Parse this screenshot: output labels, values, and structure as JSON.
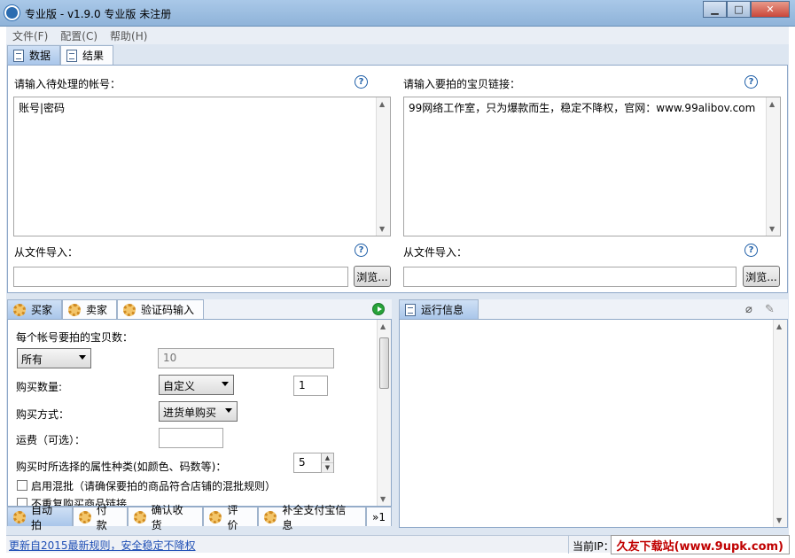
{
  "window": {
    "title": "专业版 - v1.9.0 专业版 未注册",
    "min": "▁",
    "max": "□",
    "close": "✕"
  },
  "menu": {
    "file": "文件(F)",
    "config": "配置(C)",
    "help": "帮助(H)"
  },
  "top_tabs": {
    "data": "数据",
    "result": "结果"
  },
  "accounts": {
    "label": "请输入待处理的帐号：",
    "value": "账号|密码",
    "import_label": "从文件导入：",
    "browse": "浏览..."
  },
  "links": {
    "label": "请输入要拍的宝贝链接：",
    "value": "99网络工作室，只为爆款而生，稳定不降权，官网：www.99alibov.com",
    "import_label": "从文件导入：",
    "browse": "浏览..."
  },
  "help": "?",
  "role_tabs": {
    "buyer": "买家",
    "seller": "卖家",
    "captcha": "验证码输入"
  },
  "buyer": {
    "items_label": "每个帐号要拍的宝贝数：",
    "items_select": "所有",
    "items_value": "10",
    "qty_label": "购买数量:",
    "qty_select": "自定义",
    "qty_value": "1",
    "method_label": "购买方式：",
    "method_select": "进货单购买",
    "shipping_label": "运费（可选）：",
    "shipping_value": "",
    "attr_label": "购买时所选择的属性种类(如颜色、码数等)：",
    "attr_value": "5",
    "batch_label": "启用混批（请确保要拍的商品符合店铺的混批规则）",
    "nodup_label": "不重复购买商品链接"
  },
  "bottom_tabs": {
    "auto": "自动拍",
    "pay": "付款",
    "confirm": "确认收货",
    "rate": "评价",
    "alipay": "补全支付宝信息",
    "more": "»1"
  },
  "log": {
    "title": "运行信息"
  },
  "status": {
    "update": "更新自2015最新规则，安全稳定不降权",
    "ip_label": "当前IP："
  },
  "watermark": "久友下载站(www.9upk.com)"
}
